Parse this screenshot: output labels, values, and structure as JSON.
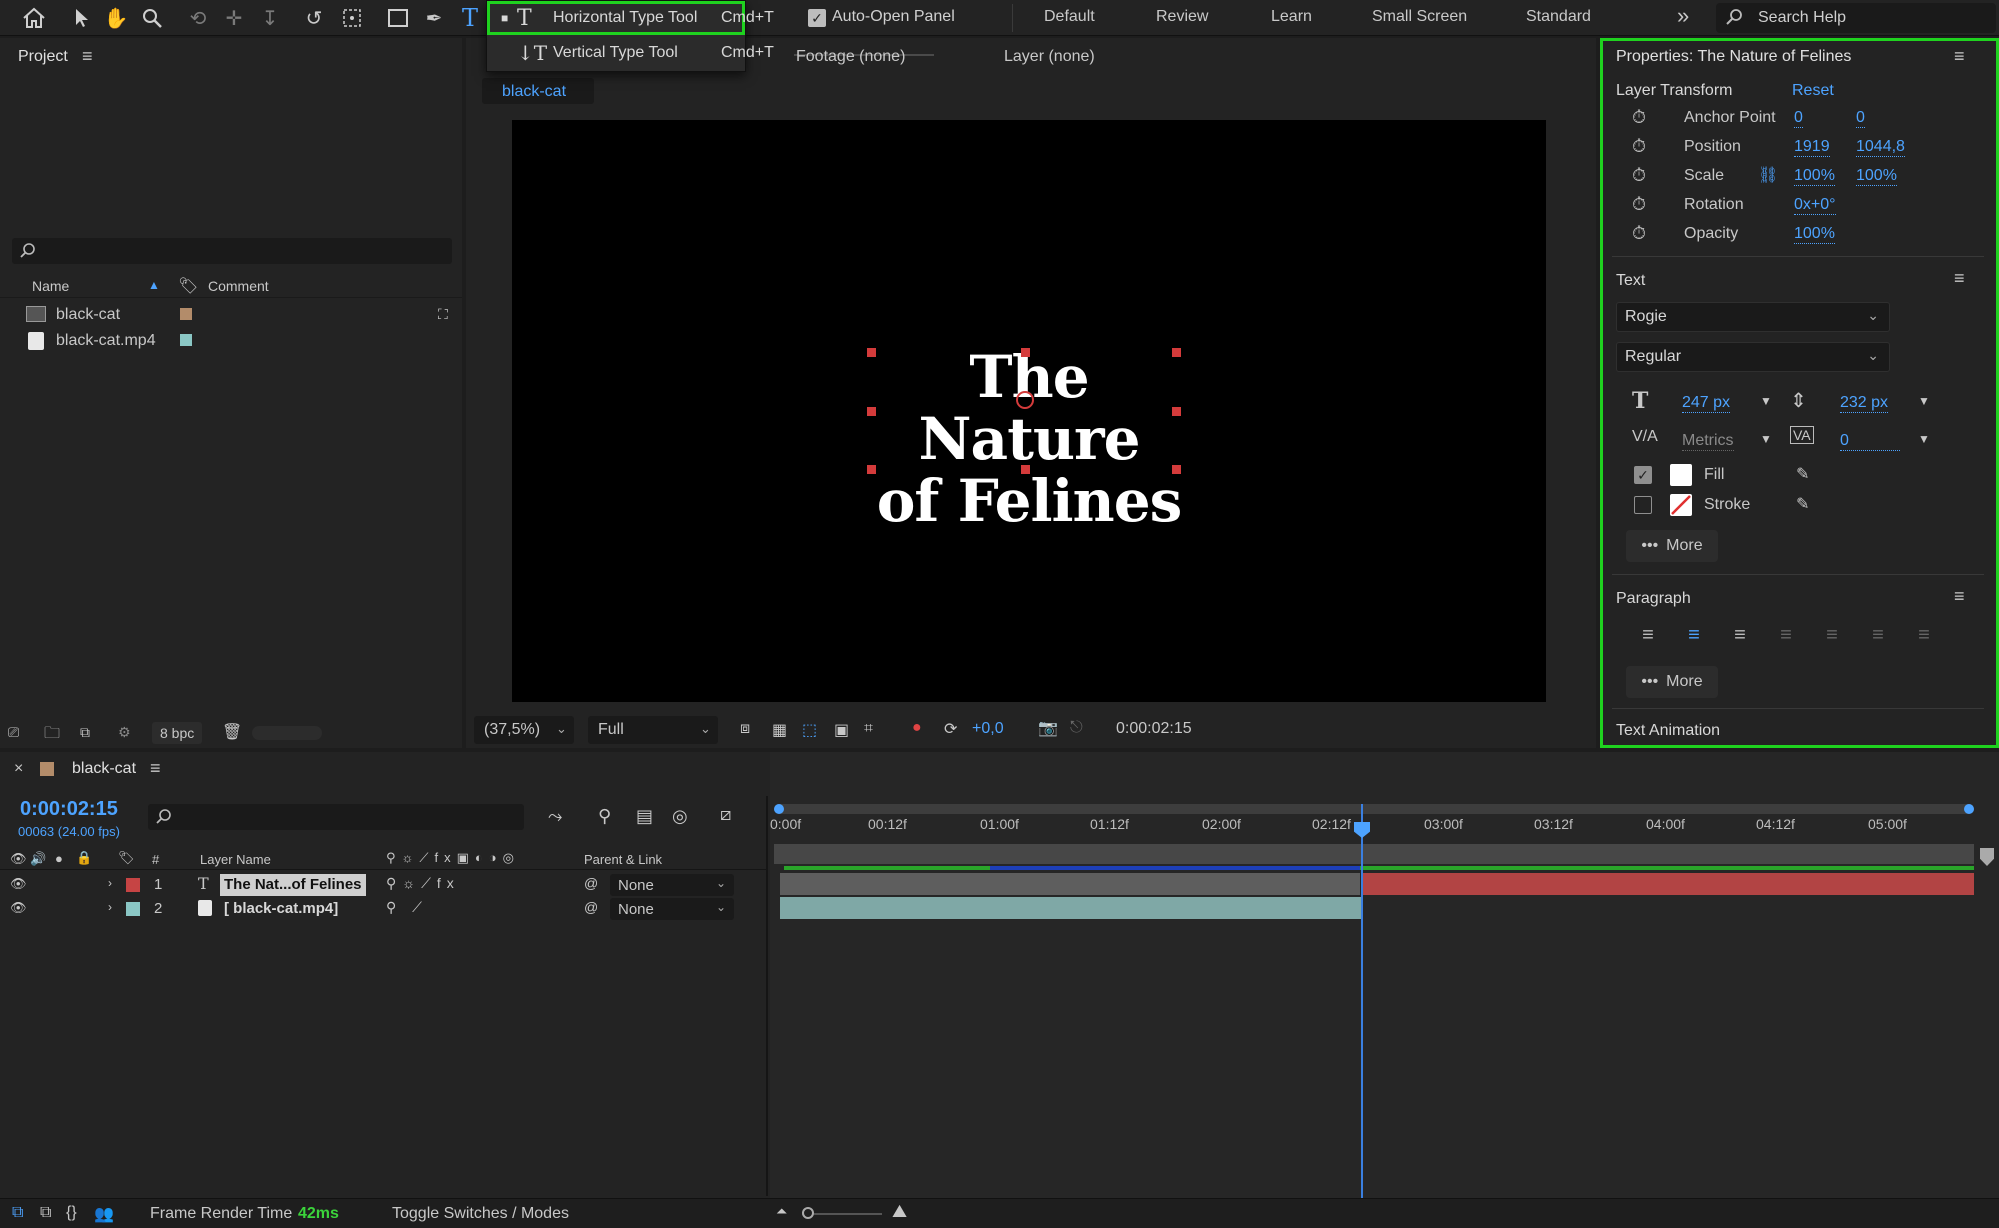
{
  "toolbar": {
    "icons": [
      "home-icon",
      "selection-tool-icon",
      "hand-tool-icon",
      "zoom-tool-icon",
      "orbit-tool-icon",
      "pan-tool-icon",
      "dolly-tool-icon",
      "rotate-tool-icon",
      "pan-behind-tool-icon",
      "rectangle-tool-icon",
      "pen-tool-icon",
      "type-tool-icon"
    ],
    "auto_open_label": "Auto-Open Panel",
    "workspaces": [
      "Default",
      "Review",
      "Learn",
      "Small Screen",
      "Standard"
    ],
    "more_label": "»",
    "search_placeholder": "Search Help"
  },
  "type_menu": {
    "items": [
      {
        "label": "Horizontal Type Tool",
        "shortcut": "Cmd+T"
      },
      {
        "label": "Vertical Type Tool",
        "shortcut": "Cmd+T"
      }
    ]
  },
  "project": {
    "title": "Project",
    "columns": {
      "name": "Name",
      "comment": "Comment"
    },
    "items": [
      {
        "name": "black-cat",
        "color": "#b38c6a"
      },
      {
        "name": "black-cat.mp4",
        "color": "#8ac6c4"
      }
    ],
    "bpc_label": "8 bpc"
  },
  "composition": {
    "viewer_tabs": [
      "Footage (none)",
      "Layer (none)"
    ],
    "comp_tab": "black-cat",
    "canvas_text_line1": "The Nature",
    "canvas_text_line2": "of Felines",
    "zoom": "(37,5%)",
    "resolution": "Full",
    "exposure": "+0,0",
    "timecode": "0:00:02:15"
  },
  "properties": {
    "title": "Properties: The Nature of Felines",
    "layer_transform": {
      "label": "Layer Transform",
      "reset": "Reset",
      "rows": [
        {
          "name": "Anchor Point",
          "v1": "0",
          "v2": "0"
        },
        {
          "name": "Position",
          "v1": "1919",
          "v2": "1044,8"
        },
        {
          "name": "Scale",
          "v1": "100%",
          "v2": "100%"
        },
        {
          "name": "Rotation",
          "v1": "0x+0°",
          "v2": ""
        },
        {
          "name": "Opacity",
          "v1": "100%",
          "v2": ""
        }
      ]
    },
    "text": {
      "label": "Text",
      "font": "Rogie",
      "style": "Regular",
      "font_size": "247 px",
      "leading": "232 px",
      "kerning": "Metrics",
      "tracking": "0",
      "fill_label": "Fill",
      "stroke_label": "Stroke",
      "more_label": "More"
    },
    "paragraph": {
      "label": "Paragraph",
      "more_label": "More"
    },
    "text_animation_label": "Text Animation"
  },
  "timeline": {
    "tab_label": "black-cat",
    "current_time": "0:00:02:15",
    "frame_info": "00063 (24.00 fps)",
    "col_hash": "#",
    "col_layer_name": "Layer Name",
    "col_parent": "Parent & Link",
    "ruler_labels": [
      "0:00f",
      "00:12f",
      "01:00f",
      "01:12f",
      "02:00f",
      "02:12f",
      "03:00f",
      "03:12f",
      "04:00f",
      "04:12f",
      "05:00f"
    ],
    "layers": [
      {
        "num": "1",
        "name": "The Nat...of Felines",
        "color": "#c64444",
        "parent": "None"
      },
      {
        "num": "2",
        "name": "[ black-cat.mp4]",
        "color": "#8ac6c4",
        "parent": "None"
      }
    ]
  },
  "status": {
    "render_label": "Frame Render Time",
    "render_value": "42ms",
    "toggle_label": "Toggle Switches / Modes"
  }
}
